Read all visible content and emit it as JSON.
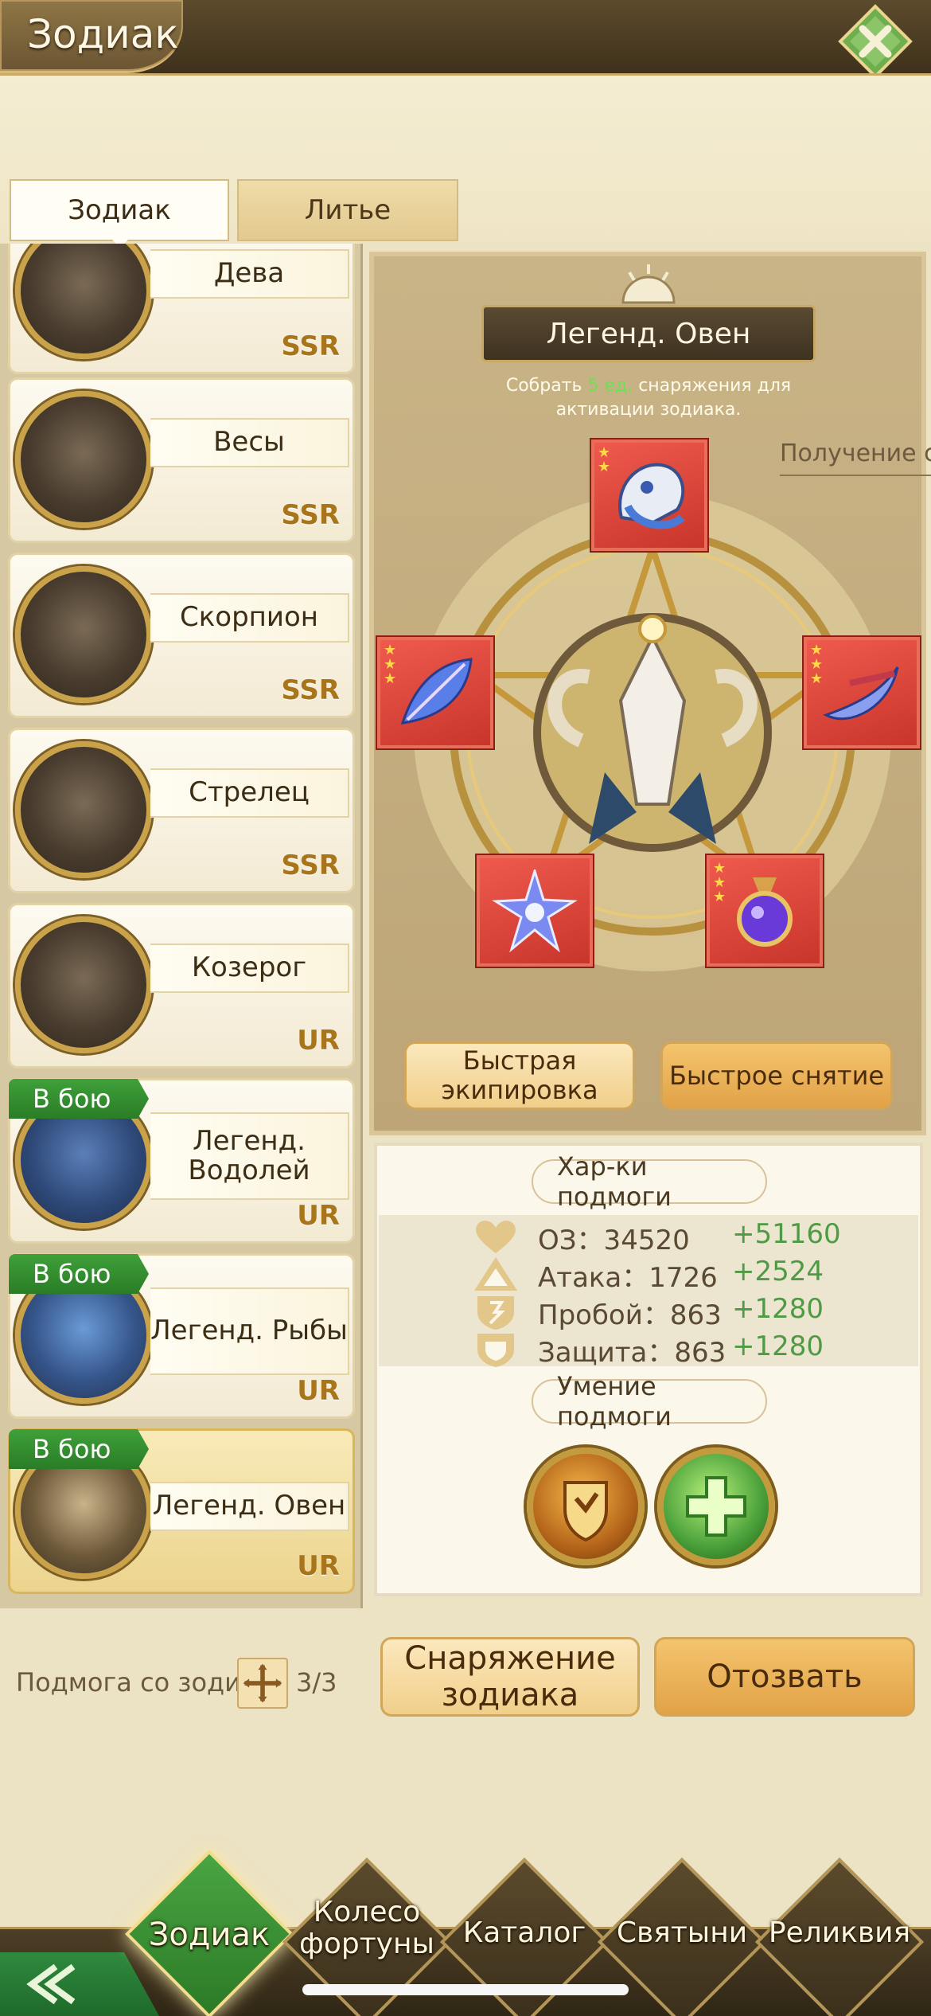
{
  "header": {
    "title": "Зодиак"
  },
  "tabs": [
    {
      "label": "Зодиак",
      "active": true
    },
    {
      "label": "Литье",
      "active": false
    }
  ],
  "zodiac_list": [
    {
      "name": "Дева",
      "rarity": "SSR",
      "in_battle": false
    },
    {
      "name": "Весы",
      "rarity": "SSR",
      "in_battle": false
    },
    {
      "name": "Скорпион",
      "rarity": "SSR",
      "in_battle": false
    },
    {
      "name": "Стрелец",
      "rarity": "SSR",
      "in_battle": false
    },
    {
      "name": "Козерог",
      "rarity": "UR",
      "in_battle": false
    },
    {
      "name": "Легенд. Водолей",
      "rarity": "UR",
      "in_battle": true
    },
    {
      "name": "Легенд. Рыбы",
      "rarity": "UR",
      "in_battle": true
    },
    {
      "name": "Легенд. Овен",
      "rarity": "UR",
      "in_battle": true,
      "selected": true
    }
  ],
  "battle_badge": "В бою",
  "detail": {
    "name": "Легенд. Овен",
    "hint_prefix": "Собрать",
    "hint_count": "5 ед.",
    "hint_suffix": "снаряжения для активации зодиака.",
    "obtain_link": "Получение с",
    "equipment_stars": [
      2,
      3,
      3,
      0,
      3
    ],
    "quick_equip": "Быстрая экипировка",
    "quick_remove": "Быстрое снятие"
  },
  "stats": {
    "title": "Хар-ки подмоги",
    "rows": [
      {
        "icon": "heart-icon",
        "label": "ОЗ：34520",
        "bonus": "+51160"
      },
      {
        "icon": "attack-icon",
        "label": "Атака：1726",
        "bonus": "+2524"
      },
      {
        "icon": "pierce-icon",
        "label": "Пробой：863",
        "bonus": "+1280"
      },
      {
        "icon": "defense-icon",
        "label": "Защита：863",
        "bonus": "+1280"
      }
    ],
    "skill_title": "Умение подмоги"
  },
  "bottom": {
    "support_label": "Подмога со зодиа",
    "support_count": "3/3",
    "equipment_button": "Снаряжение зодиака",
    "recall_button": "Отозвать"
  },
  "nav": [
    {
      "label": "Зодиак",
      "active": true
    },
    {
      "label": "Колесо фортуны",
      "active": false
    },
    {
      "label": "Каталог",
      "active": false
    },
    {
      "label": "Святыни",
      "active": false
    },
    {
      "label": "Реликвия",
      "active": false
    }
  ],
  "colors": {
    "accent_gold": "#c9a24a",
    "battle_green": "#2a7d26",
    "bonus_green": "#4f9a45",
    "slot_red": "#c8352a"
  }
}
